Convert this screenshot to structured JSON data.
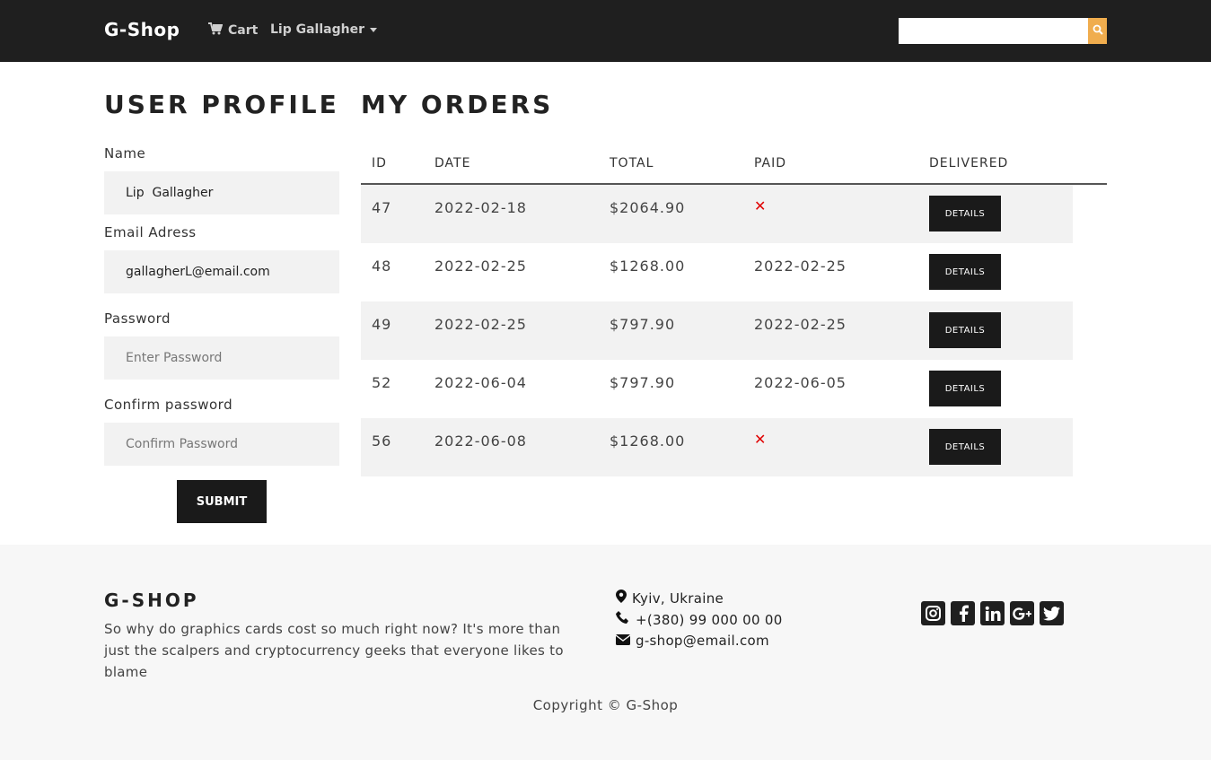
{
  "navbar": {
    "brand": "G-Shop",
    "cart_label": "Cart",
    "user_label": "Lip Gallagher",
    "search": {
      "value": "",
      "placeholder": ""
    },
    "accent_color": "#f0ad4e"
  },
  "profile": {
    "title": "USER PROFILE",
    "name_label": "Name",
    "name_value": "Lip  Gallagher",
    "email_label": "Email Adress",
    "email_value": "gallagherL@email.com",
    "password_label": "Password",
    "password_placeholder": "Enter Password",
    "confirm_label": "Confirm password",
    "confirm_placeholder": "Confirm Password",
    "submit_label": "SUBMIT"
  },
  "orders": {
    "title": "MY ORDERS",
    "columns": [
      "ID",
      "DATE",
      "TOTAL",
      "PAID",
      "DELIVERED"
    ],
    "details_label": "DETAILS",
    "not_paid_icon": "x-mark-icon",
    "not_paid_color": "#e00000",
    "rows": [
      {
        "id": "47",
        "date": "2022-02-18",
        "total": "$2064.90",
        "paid": null
      },
      {
        "id": "48",
        "date": "2022-02-25",
        "total": "$1268.00",
        "paid": "2022-02-25"
      },
      {
        "id": "49",
        "date": "2022-02-25",
        "total": "$797.90",
        "paid": "2022-02-25"
      },
      {
        "id": "52",
        "date": "2022-06-04",
        "total": "$797.90",
        "paid": "2022-06-05"
      },
      {
        "id": "56",
        "date": "2022-06-08",
        "total": "$1268.00",
        "paid": null
      }
    ]
  },
  "footer": {
    "brand": "G-SHOP",
    "description": "So why do graphics cards cost so much right now? It's more than just the scalpers and cryptocurrency geeks that everyone likes to blame",
    "location": "Kyiv, Ukraine",
    "phone": "+(380) 99 000 00 00",
    "email": "g-shop@email.com",
    "socials": [
      "instagram-icon",
      "facebook-icon",
      "linkedin-icon",
      "google-plus-icon",
      "twitter-icon"
    ],
    "copyright": "Copyright © G-Shop"
  }
}
